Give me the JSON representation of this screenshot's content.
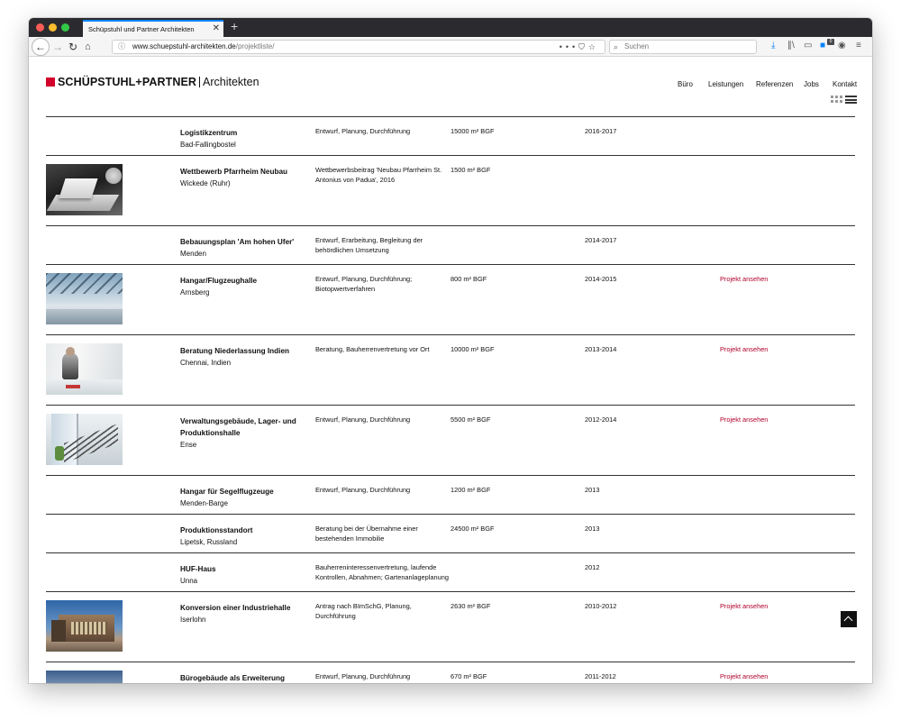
{
  "browser": {
    "tab_title": "Schüpstuhl und Partner Architekten",
    "url_host": "www.schuepstuhl-architekten.de",
    "url_path": "/projektliste/",
    "search_placeholder": "Suchen",
    "extension_badge": "0"
  },
  "site": {
    "logo_bold": "SCHÜPSTUHL+PARTNER",
    "logo_light": "Architekten",
    "nav": [
      "Büro",
      "Leistungen",
      "Referenzen",
      "Jobs",
      "Kontakt"
    ]
  },
  "projects": [
    {
      "title": "Logistikzentrum",
      "location": "Bad-Fallingbostel",
      "services": "Entwurf, Planung, Durchführung",
      "area": "15000 m² BGF",
      "years": "2016-2017",
      "link": "",
      "thumb": "none"
    },
    {
      "title": "Wettbewerb Pfarrheim Neubau",
      "location": "Wickede (Ruhr)",
      "services": "Wettbewerbsbeitrag 'Neubau Pfarrheim St. Antonius von Padua', 2016",
      "area": "1500 m² BGF",
      "years": "",
      "link": "",
      "thumb": "model"
    },
    {
      "title": "Bebauungsplan 'Am hohen Ufer'",
      "location": "Menden",
      "services": "Entwurf, Erarbeitung, Begleitung der behördlichen Umsetzung",
      "area": "",
      "years": "2014-2017",
      "link": "",
      "thumb": "none"
    },
    {
      "title": "Hangar/Flugzeughalle",
      "location": "Arnsberg",
      "services": "Entwurf, Planung, Durchführung; Biotopwertverfahren",
      "area": "800 m² BGF",
      "years": "2014-2015",
      "link": "Projekt ansehen",
      "thumb": "hangar"
    },
    {
      "title": "Beratung Niederlassung Indien",
      "location": "Chennai, Indien",
      "services": "Beratung, Bauherrenvertretung vor Ort",
      "area": "10000 m² BGF",
      "years": "2013-2014",
      "link": "Projekt ansehen",
      "thumb": "office"
    },
    {
      "title": "Verwaltungsgebäude, Lager- und Produktionshalle",
      "location": "Ense",
      "services": "Entwurf, Planung, Durchführung",
      "area": "5500 m² BGF",
      "years": "2012-2014",
      "link": "Projekt ansehen",
      "thumb": "stairs"
    },
    {
      "title": "Hangar für Segelflugzeuge",
      "location": "Menden-Barge",
      "services": "Entwurf, Planung, Durchführung",
      "area": "1200 m² BGF",
      "years": "2013",
      "link": "",
      "thumb": "none"
    },
    {
      "title": "Produktionsstandort",
      "location": "Lipetsk, Russland",
      "services": "Beratung bei der Übernahme einer bestehenden Immobilie",
      "area": "24500 m² BGF",
      "years": "2013",
      "link": "",
      "thumb": "none"
    },
    {
      "title": "HUF-Haus",
      "location": "Unna",
      "services": "Bauherreninteressenvertretung, laufende Kontrollen, Abnahmen; Gartenanlageplanung",
      "area": "",
      "years": "2012",
      "link": "",
      "thumb": "none"
    },
    {
      "title": "Konversion einer Industriehalle",
      "location": "Iserlohn",
      "services": "Antrag nach BImSchG, Planung, Durchführung",
      "area": "2630 m² BGF",
      "years": "2010-2012",
      "link": "Projekt ansehen",
      "thumb": "building"
    },
    {
      "title": "Bürogebäude als Erweiterung",
      "location": "",
      "services": "Entwurf, Planung, Durchführung",
      "area": "670 m² BGF",
      "years": "2011-2012",
      "link": "Projekt ansehen",
      "thumb": "office2"
    }
  ],
  "colors": {
    "brand_red": "#d2002a",
    "link_red": "#b0002a"
  }
}
